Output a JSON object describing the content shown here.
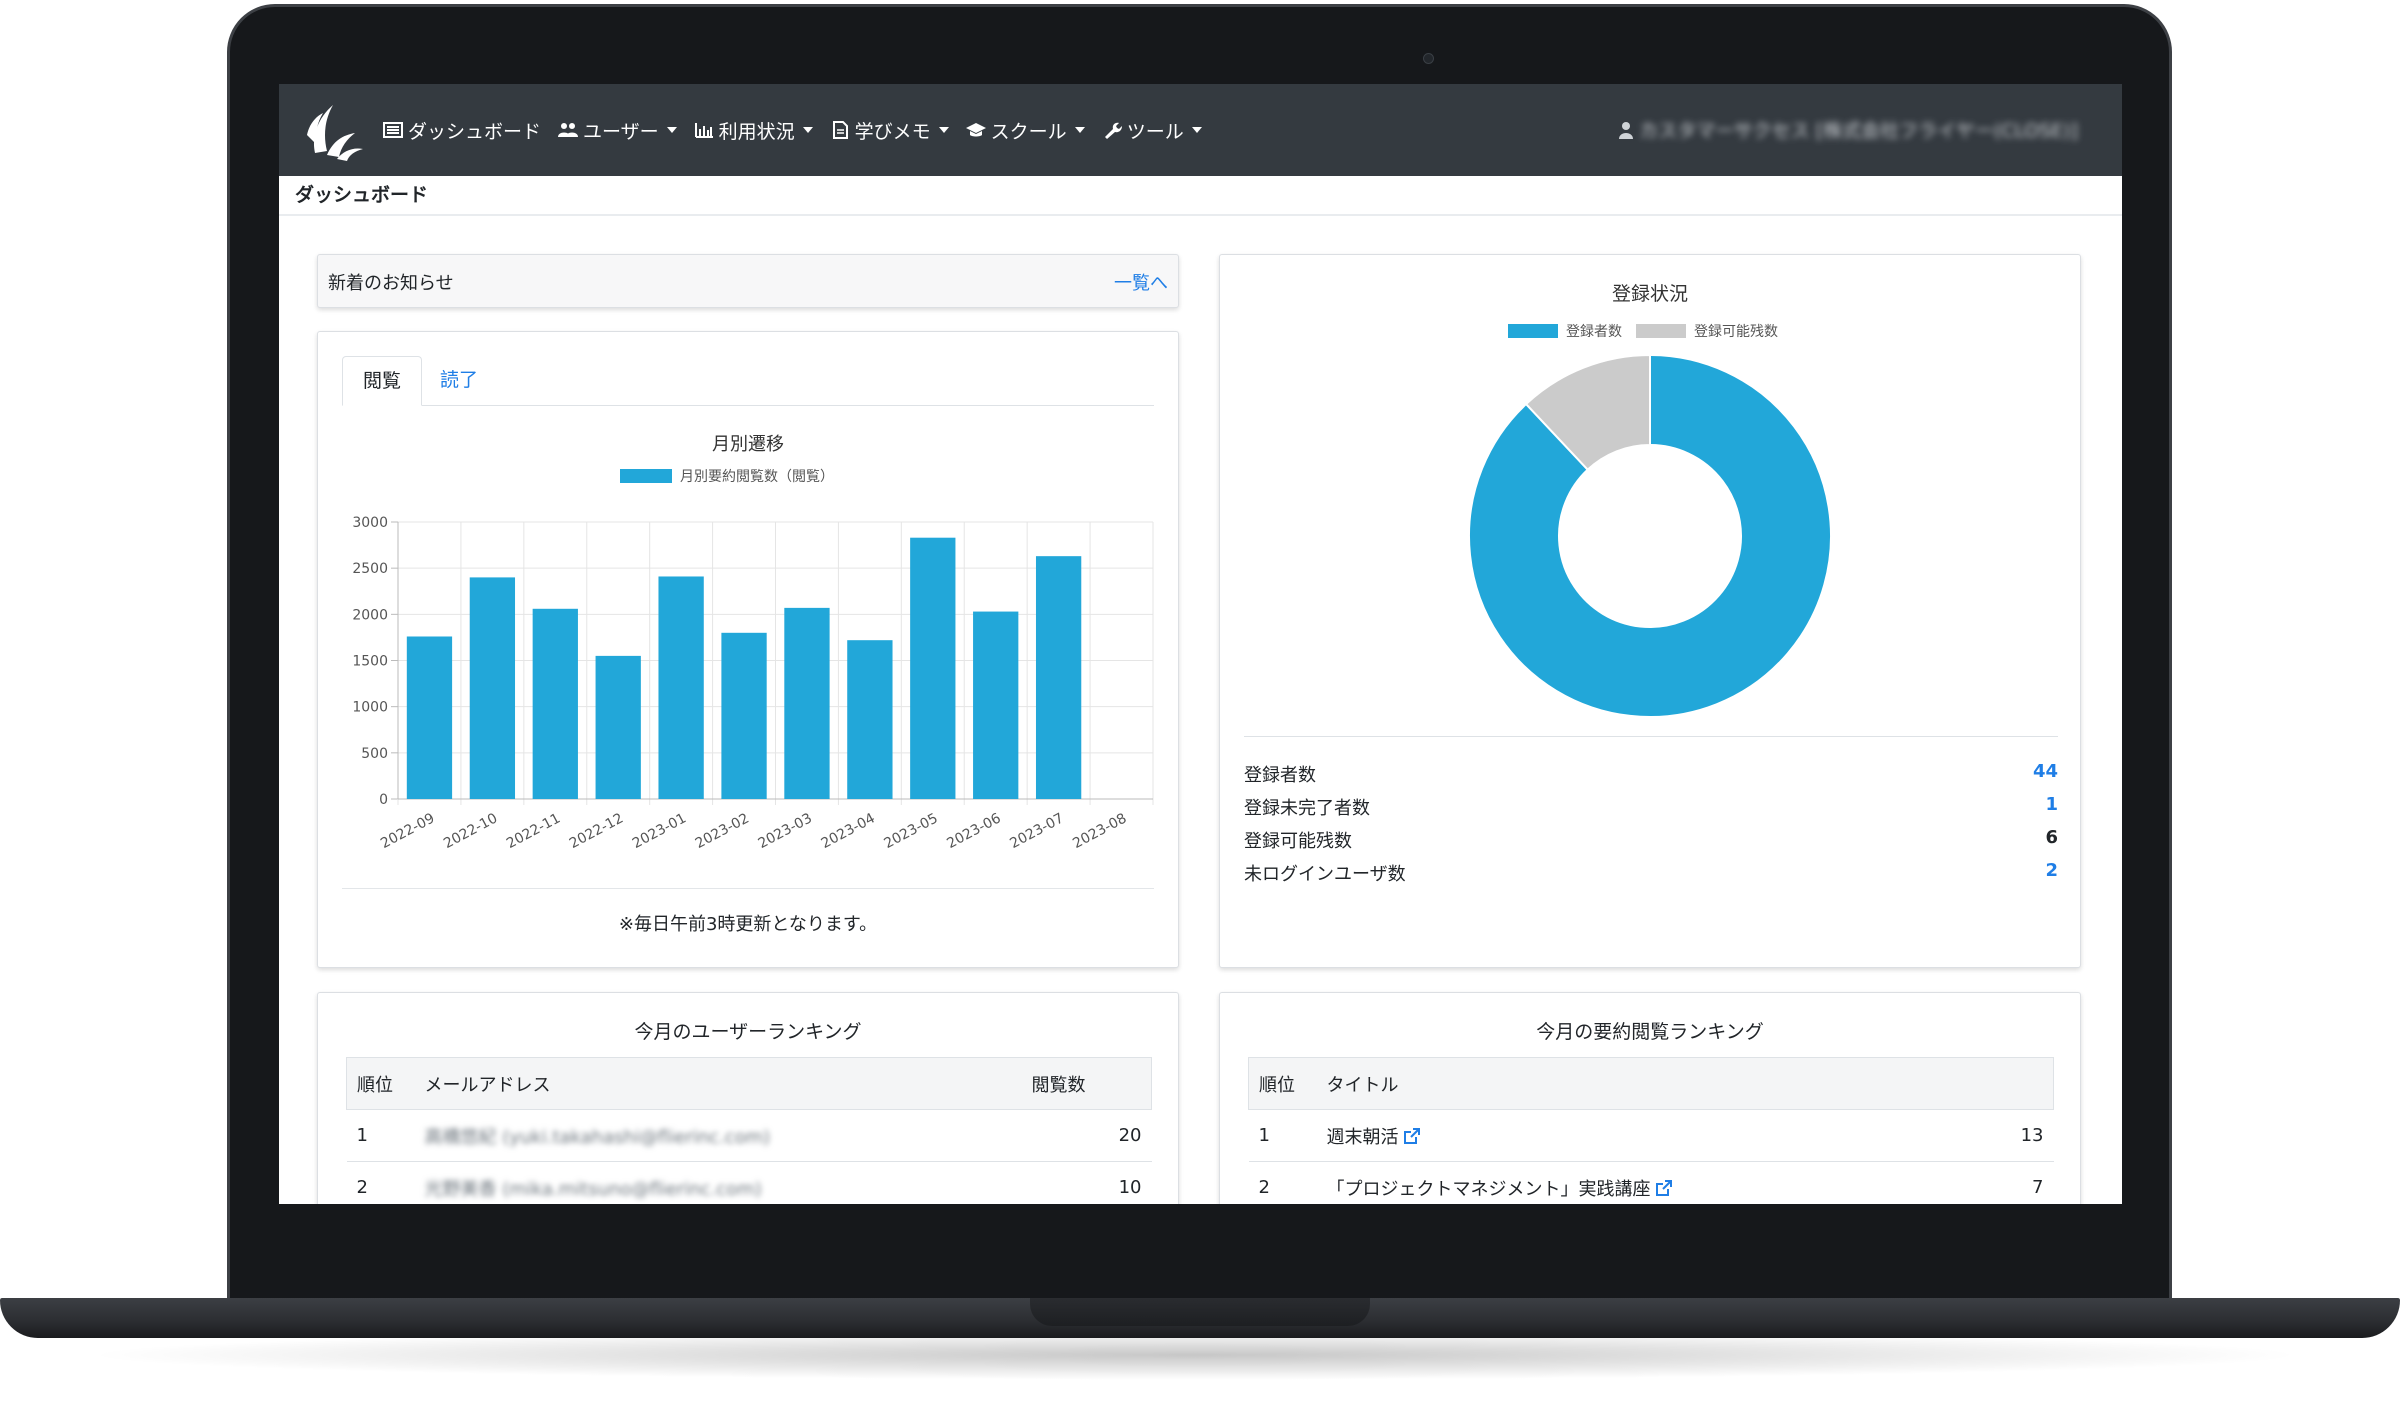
{
  "navbar": {
    "items": [
      {
        "label": "ダッシュボード",
        "icon": "dashboard-icon",
        "dropdown": false
      },
      {
        "label": "ユーザー",
        "icon": "users-icon",
        "dropdown": true
      },
      {
        "label": "利用状況",
        "icon": "bar-chart-icon",
        "dropdown": true
      },
      {
        "label": "学びメモ",
        "icon": "memo-icon",
        "dropdown": true
      },
      {
        "label": "スクール",
        "icon": "graduation-cap-icon",
        "dropdown": true
      },
      {
        "label": "ツール",
        "icon": "wrench-icon",
        "dropdown": true
      }
    ],
    "user_label": "カスタマーサクセス [株式会社フライヤー(CLOSE)]"
  },
  "breadcrumb": "ダッシュボード",
  "news": {
    "title": "新着のお知らせ",
    "link": "一覧へ"
  },
  "tabs": [
    {
      "label": "閲覧"
    },
    {
      "label": "読了"
    }
  ],
  "chart_note": "※毎日午前3時更新となります。",
  "chart_data": [
    {
      "type": "bar",
      "title": "月別遷移",
      "legend": "top",
      "grid": true,
      "categories": [
        "2022-09",
        "2022-10",
        "2022-11",
        "2022-12",
        "2023-01",
        "2023-02",
        "2023-03",
        "2023-04",
        "2023-05",
        "2023-06",
        "2023-07",
        "2023-08"
      ],
      "series": [
        {
          "name": "月別要約閲覧数（閲覧）",
          "color": "#22a7d9",
          "values": [
            1760,
            2400,
            2060,
            1550,
            2410,
            1800,
            2070,
            1720,
            2830,
            2030,
            2630,
            0
          ]
        }
      ],
      "ylim": [
        0,
        3000
      ],
      "yticks": [
        0,
        500,
        1000,
        1500,
        2000,
        2500,
        3000
      ]
    },
    {
      "type": "pie",
      "title": "登録状況",
      "legend": "top",
      "series": [
        {
          "name": "登録者数",
          "value": 44,
          "color": "#22a7d9"
        },
        {
          "name": "登録可能残数",
          "value": 6,
          "color": "#cbcbcb"
        }
      ]
    }
  ],
  "registration_stats": [
    {
      "label": "登録者数",
      "value": "44",
      "link": true
    },
    {
      "label": "登録未完了者数",
      "value": "1",
      "link": true
    },
    {
      "label": "登録可能残数",
      "value": "6",
      "link": false
    },
    {
      "label": "未ログインユーザ数",
      "value": "2",
      "link": true
    }
  ],
  "user_ranking": {
    "title": "今月のユーザーランキング",
    "headers": [
      "順位",
      "メールアドレス",
      "閲覧数"
    ],
    "rows": [
      {
        "rank": "1",
        "email": "高橋悠紀 (yuki.takahashi@flierinc.com)",
        "count": "20"
      },
      {
        "rank": "2",
        "email": "光野美香 (mika.mitsuno@flierinc.com)",
        "count": "10"
      }
    ]
  },
  "book_ranking": {
    "title": "今月の要約閲覧ランキング",
    "headers": [
      "順位",
      "タイトル",
      ""
    ],
    "rows": [
      {
        "rank": "1",
        "title": "週末朝活",
        "count": "13"
      },
      {
        "rank": "2",
        "title": "「プロジェクトマネジメント」実践講座",
        "count": "7"
      }
    ]
  },
  "colors": {
    "navbar": "#343a40",
    "accent": "#22a7d9",
    "link": "#1f7ee6",
    "remaining": "#cbcbcb"
  }
}
